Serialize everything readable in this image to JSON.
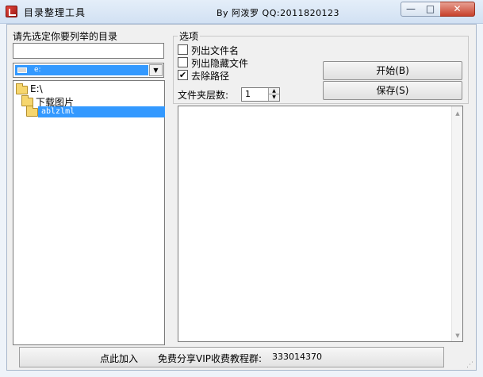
{
  "window": {
    "title": "目录整理工具",
    "author": "By 阿泼罗 QQ:2011820123",
    "min_glyph": "—",
    "max_glyph": "□",
    "close_glyph": "✕"
  },
  "left": {
    "choose_label": "请先选定你要列举的目录",
    "path_value": "",
    "drive_value": "e:",
    "tree": [
      {
        "label": "E:\\",
        "icon": "folder-open-icon"
      },
      {
        "label": "下载图片",
        "icon": "folder-open-icon"
      },
      {
        "label": "ablzlml",
        "icon": "folder-icon",
        "selected": true
      }
    ]
  },
  "options": {
    "group_title": "选项",
    "checkboxes": [
      {
        "label": "列出文件名",
        "checked": false
      },
      {
        "label": "列出隐藏文件",
        "checked": false
      },
      {
        "label": "去除路径",
        "checked": true
      }
    ],
    "check_glyph": "✔",
    "start_button": "开始(B)",
    "save_button": "保存(S)",
    "depth_label": "文件夹层数:",
    "depth_value": "1",
    "spin_up_glyph": "▲",
    "spin_down_glyph": "▼"
  },
  "output": {
    "text": "",
    "scroll_up_glyph": "▲",
    "scroll_down_glyph": "▼"
  },
  "bottom": {
    "add_label": "点此加入",
    "share_label": "免费分享VIP收费教程群:",
    "qq_number": "333014370"
  },
  "combo_arrow_glyph": "▼"
}
